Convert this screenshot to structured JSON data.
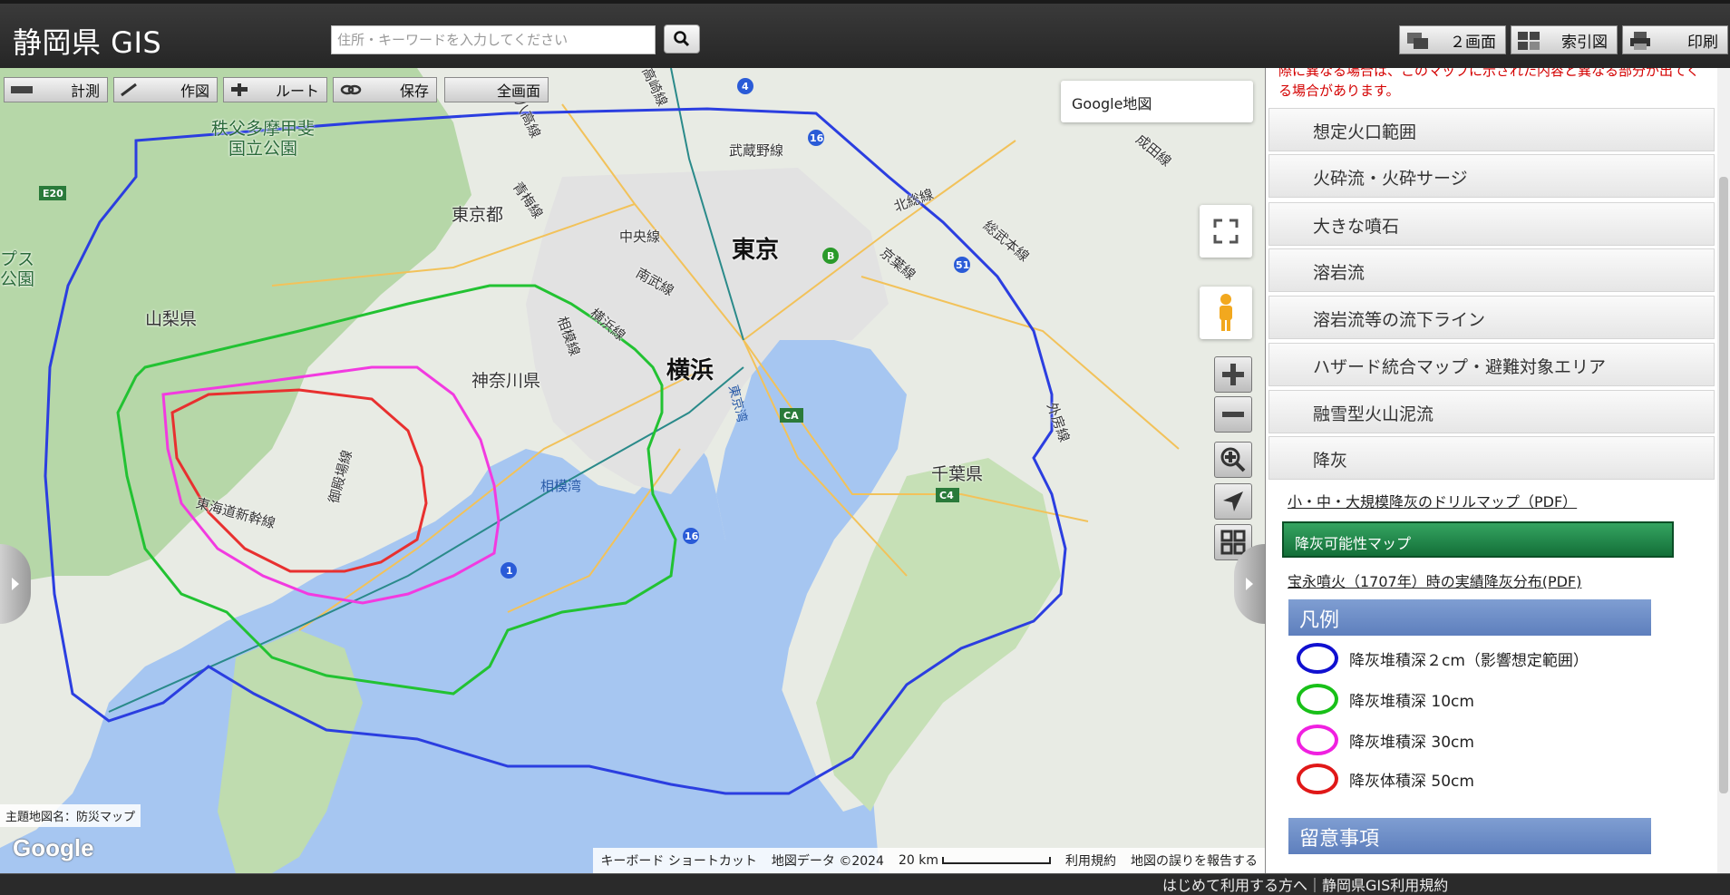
{
  "header": {
    "title": "静岡県 GIS",
    "search_placeholder": "住所・キーワードを入力してください",
    "buttons": {
      "split": "２画面",
      "index": "索引図",
      "print": "印刷"
    }
  },
  "toolbar": {
    "measure": "計測",
    "draw": "作図",
    "route": "ルート",
    "save": "保存",
    "fullscreen": "全画面"
  },
  "map": {
    "basemap": "Google地図",
    "theme": "主題地図名：防災マップ",
    "attribution": {
      "shortcuts": "キーボード ショートカット",
      "data": "地図データ ©2024",
      "scale": "20 km",
      "terms": "利用規約",
      "report": "地図の誤りを報告する"
    },
    "google": "Google",
    "labels": {
      "tokyo": "東京",
      "yokohama": "横浜",
      "tokyoto": "東京都",
      "yamanashi": "山梨県",
      "kanagawa": "神奈川県",
      "chiba": "千葉県",
      "chichibu": "秩父多摩甲斐\n国立公園",
      "sagamiwan": "相模湾",
      "musashino": "武蔵野線",
      "chuo": "中央線",
      "nambu": "南武線",
      "yokohamasen": "横浜線",
      "sagami": "相模線",
      "keiyo": "京葉線",
      "ome": "青梅線",
      "tokaido": "東海道新幹線",
      "gotemba": "御殿場線",
      "hachiko": "八高線",
      "hokuso": "北総線",
      "sobu": "総武本線",
      "sotobo": "外房線",
      "tokyowan": "東京湾",
      "alps": "プス\n公園",
      "takasaki": "高崎線",
      "seikei": "成田線"
    },
    "colors": {
      "blue": "#2b3ee0",
      "green": "#22c232",
      "magenta": "#f23ae0",
      "red": "#e8302f"
    }
  },
  "panel": {
    "notice": "際に異なる場合は、このマップに示された内容と異なる部分が出てくる場合があります。",
    "layers": [
      "想定火口範囲",
      "火砕流・火砕サージ",
      "大きな噴石",
      "溶岩流",
      "溶岩流等の流下ライン",
      "ハザード統合マップ・避難対象エリア",
      "融雪型火山泥流",
      "降灰"
    ],
    "links": {
      "drill": "小・中・大規模降灰のドリルマップ（PDF）",
      "map_button": "降灰可能性マップ",
      "hoei": "宝永噴火（1707年）時の実績降灰分布(PDF)"
    },
    "legend": {
      "title": "凡例",
      "items": [
        {
          "label": "降灰堆積深２cm（影響想定範囲）",
          "color": "#1010d0"
        },
        {
          "label": "降灰堆積深 10cm",
          "color": "#18c018"
        },
        {
          "label": "降灰堆積深 30cm",
          "color": "#f020e0"
        },
        {
          "label": "降灰体積深 50cm",
          "color": "#e01818"
        }
      ]
    },
    "notes_title": "留意事項"
  },
  "footer": {
    "link": "はじめて利用する方へ｜静岡県GIS利用規約"
  }
}
